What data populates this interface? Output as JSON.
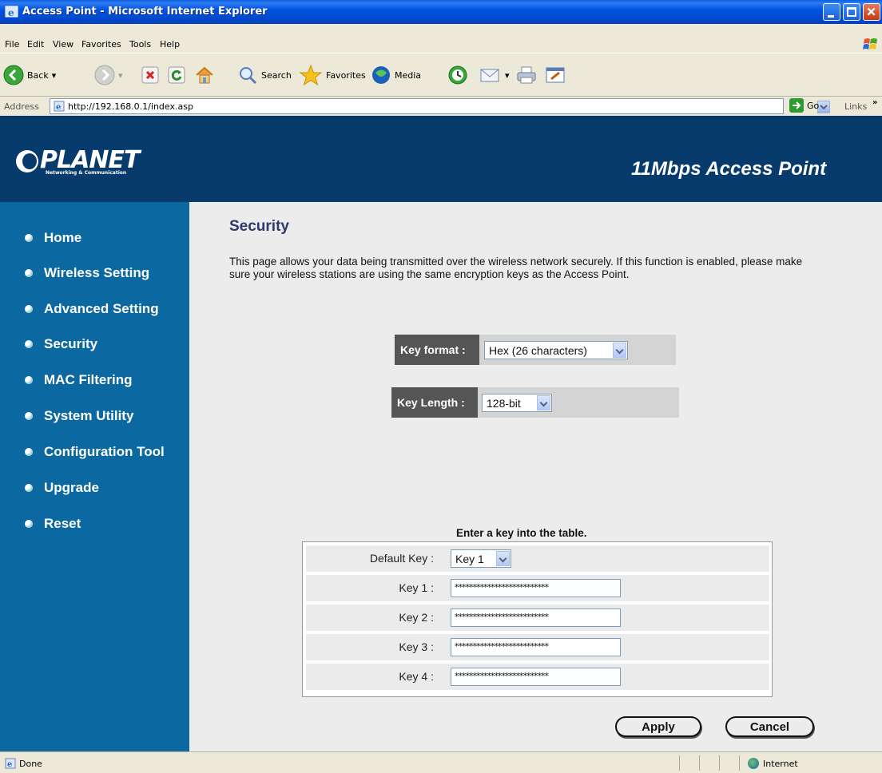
{
  "window": {
    "title": "Access Point - Microsoft Internet Explorer"
  },
  "menubar": {
    "items": [
      "File",
      "Edit",
      "View",
      "Favorites",
      "Tools",
      "Help"
    ]
  },
  "toolbar": {
    "back_label": "Back",
    "search_label": "Search",
    "favorites_label": "Favorites",
    "media_label": "Media"
  },
  "addressbar": {
    "label": "Address",
    "url": "http://192.168.0.1/index.asp",
    "go_label": "Go",
    "links_label": "Links"
  },
  "banner": {
    "logo_text": "PLANET",
    "logo_subtext": "Networking & Communication",
    "product_name": "11Mbps Access Point"
  },
  "sidebar": {
    "items": [
      {
        "label": "Home"
      },
      {
        "label": "Wireless Setting"
      },
      {
        "label": "Advanced Setting"
      },
      {
        "label": "Security"
      },
      {
        "label": "MAC Filtering"
      },
      {
        "label": "System Utility"
      },
      {
        "label": "Configuration Tool"
      },
      {
        "label": "Upgrade"
      },
      {
        "label": "Reset"
      }
    ]
  },
  "main": {
    "title": "Security",
    "description": "This page allows your data being transmitted over the wireless network securely. If this function is enabled, please make sure your wireless stations are using the same encryption keys as the Access Point.",
    "key_format": {
      "label": "Key format :",
      "selected": "Hex (26 characters)"
    },
    "key_length": {
      "label": "Key Length :",
      "selected": "128-bit"
    },
    "table_caption": "Enter a key into the table.",
    "default_key": {
      "label": "Default Key :",
      "selected": "Key 1"
    },
    "keys": [
      {
        "label": "Key 1 :",
        "value": "**************************"
      },
      {
        "label": "Key 2 :",
        "value": "**************************"
      },
      {
        "label": "Key 3 :",
        "value": "**************************"
      },
      {
        "label": "Key 4 :",
        "value": "**************************"
      }
    ],
    "apply_label": "Apply",
    "cancel_label": "Cancel"
  },
  "statusbar": {
    "status": "Done",
    "zone": "Internet"
  },
  "colors": {
    "banner": "#063b6b",
    "sidebar": "#0b68a0",
    "title_blue": "#2e3a6b",
    "xp_blue": "#0054e3"
  }
}
